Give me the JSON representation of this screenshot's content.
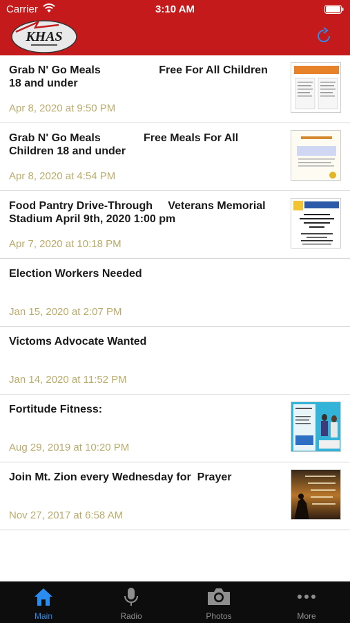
{
  "status_bar": {
    "carrier": "Carrier",
    "time": "3:10 AM"
  },
  "header": {
    "logo_text": "KHAS",
    "brand_color": "#c51a1b",
    "refresh_icon": "refresh-icon"
  },
  "items": [
    {
      "title": "Grab N' Go Meals                   Free For All Children 18 and under",
      "date": "Apr 8, 2020 at 9:50 PM",
      "has_thumb": true,
      "thumb_heading": "Grab N' Go Meals"
    },
    {
      "title": "Grab N' Go Meals              Free Meals For All Children 18 and under",
      "date": "Apr 8, 2020 at 4:54 PM",
      "has_thumb": true,
      "thumb_heading": "GRAB N' GO MEALS"
    },
    {
      "title": "Food Pantry Drive-Through     Veterans Memorial Stadium April 9th, 2020 1:00 pm",
      "date": "Apr 7, 2020 at 10:18 PM",
      "has_thumb": true,
      "thumb_heading": "Drive-Through Food Pantry Happening April 9th, 2020 1:00pm"
    },
    {
      "title": "Election Workers Needed",
      "date": "Jan 15, 2020 at 2:07 PM",
      "has_thumb": false
    },
    {
      "title": "Victoms Advocate Wanted",
      "date": "Jan 14, 2020 at 11:52 PM",
      "has_thumb": false
    },
    {
      "title": "Fortitude Fitness:",
      "date": "Aug 29, 2019 at 10:20 PM",
      "has_thumb": true,
      "thumb_heading": "Fortitude Fitness"
    },
    {
      "title": "Join Mt. Zion every Wednesday for  Prayer",
      "date": "Nov 27, 2017 at 6:58 AM",
      "has_thumb": true,
      "thumb_heading": ""
    }
  ],
  "tabbar": {
    "tabs": [
      {
        "label": "Main",
        "icon": "home-icon",
        "active": true
      },
      {
        "label": "Radio",
        "icon": "microphone-icon",
        "active": false
      },
      {
        "label": "Photos",
        "icon": "camera-icon",
        "active": false
      },
      {
        "label": "More",
        "icon": "more-icon",
        "active": false
      }
    ],
    "active_color": "#2a8cf0",
    "inactive_color": "#8e8e8e"
  }
}
